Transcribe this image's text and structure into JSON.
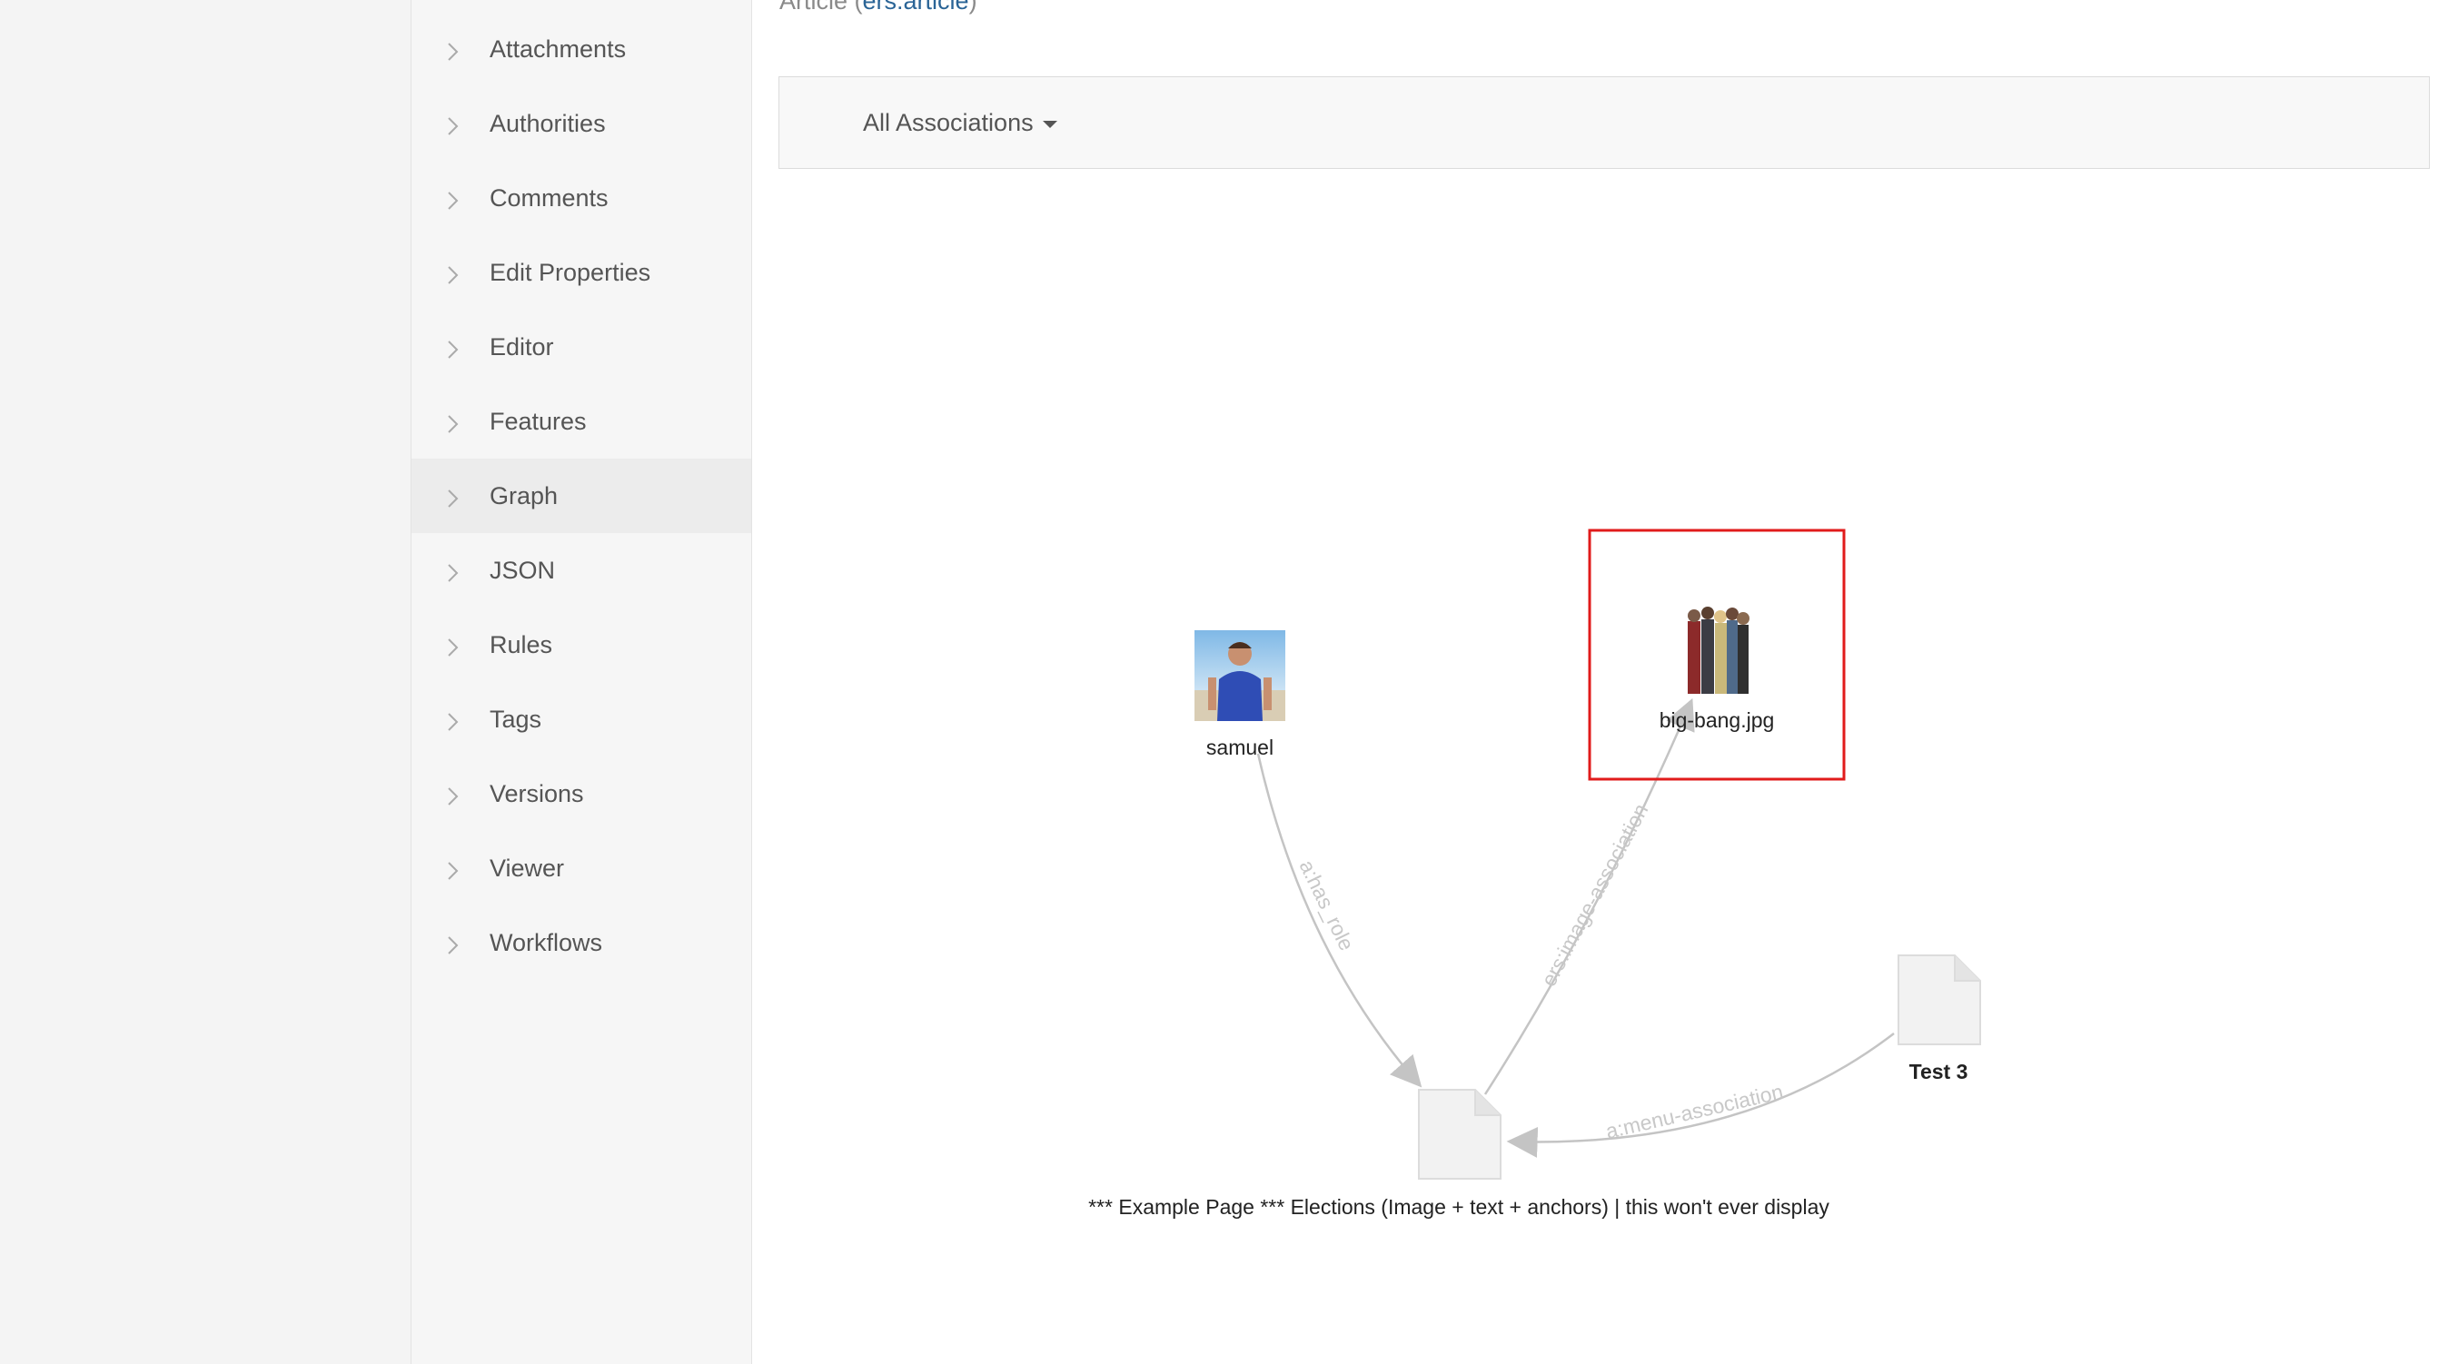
{
  "breadcrumb": {
    "type_label": "Article",
    "type_qname": "ers:article"
  },
  "sidebar": {
    "items": [
      {
        "label": "Attachments",
        "active": false
      },
      {
        "label": "Authorities",
        "active": false
      },
      {
        "label": "Comments",
        "active": false
      },
      {
        "label": "Edit Properties",
        "active": false
      },
      {
        "label": "Editor",
        "active": false
      },
      {
        "label": "Features",
        "active": false
      },
      {
        "label": "Graph",
        "active": true
      },
      {
        "label": "JSON",
        "active": false
      },
      {
        "label": "Rules",
        "active": false
      },
      {
        "label": "Tags",
        "active": false
      },
      {
        "label": "Versions",
        "active": false
      },
      {
        "label": "Viewer",
        "active": false
      },
      {
        "label": "Workflows",
        "active": false
      }
    ]
  },
  "associations": {
    "dropdown_label": "All Associations"
  },
  "graph": {
    "nodes": {
      "samuel": {
        "label": "samuel",
        "icon": "person-photo"
      },
      "big_bang": {
        "label": "big-bang.jpg",
        "icon": "group-photo",
        "selected": true
      },
      "test3": {
        "label": "Test 3",
        "icon": "document-icon"
      },
      "example_page": {
        "label": "*** Example Page *** Elections (Image + text + anchors) | this won't ever display",
        "icon": "document-icon"
      }
    },
    "edges": {
      "has_role": {
        "label": "a:has_role"
      },
      "image_association": {
        "label": "ers:image-association"
      },
      "menu_association": {
        "label": "a:menu-association"
      }
    }
  },
  "colors": {
    "selection_border": "#e11b1b",
    "edge": "#c4c4c4",
    "link": "#2a6496"
  }
}
